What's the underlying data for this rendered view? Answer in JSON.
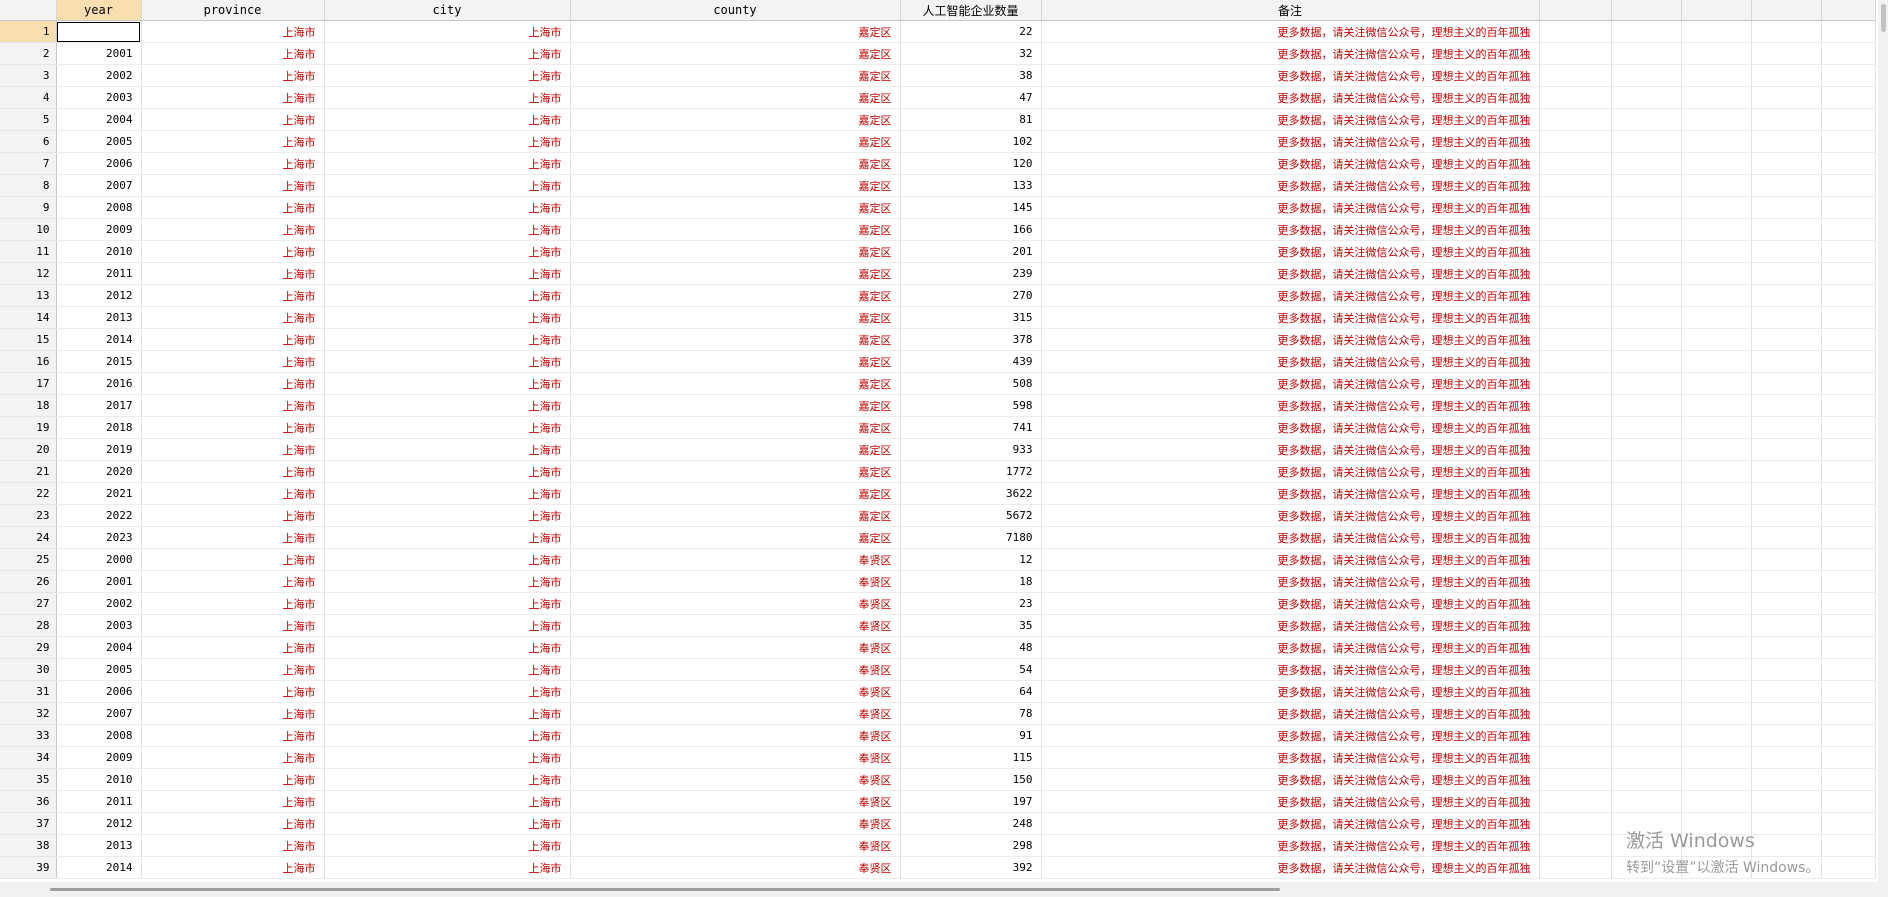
{
  "columns": [
    "year",
    "province",
    "city",
    "county",
    "人工智能企业数量",
    "备注"
  ],
  "rows": [
    [
      "",
      "上海市",
      "上海市",
      "嘉定区",
      "22",
      "更多数据，请关注微信公众号，理想主义的百年孤独"
    ],
    [
      "2001",
      "上海市",
      "上海市",
      "嘉定区",
      "32",
      "更多数据，请关注微信公众号，理想主义的百年孤独"
    ],
    [
      "2002",
      "上海市",
      "上海市",
      "嘉定区",
      "38",
      "更多数据，请关注微信公众号，理想主义的百年孤独"
    ],
    [
      "2003",
      "上海市",
      "上海市",
      "嘉定区",
      "47",
      "更多数据，请关注微信公众号，理想主义的百年孤独"
    ],
    [
      "2004",
      "上海市",
      "上海市",
      "嘉定区",
      "81",
      "更多数据，请关注微信公众号，理想主义的百年孤独"
    ],
    [
      "2005",
      "上海市",
      "上海市",
      "嘉定区",
      "102",
      "更多数据，请关注微信公众号，理想主义的百年孤独"
    ],
    [
      "2006",
      "上海市",
      "上海市",
      "嘉定区",
      "120",
      "更多数据，请关注微信公众号，理想主义的百年孤独"
    ],
    [
      "2007",
      "上海市",
      "上海市",
      "嘉定区",
      "133",
      "更多数据，请关注微信公众号，理想主义的百年孤独"
    ],
    [
      "2008",
      "上海市",
      "上海市",
      "嘉定区",
      "145",
      "更多数据，请关注微信公众号，理想主义的百年孤独"
    ],
    [
      "2009",
      "上海市",
      "上海市",
      "嘉定区",
      "166",
      "更多数据，请关注微信公众号，理想主义的百年孤独"
    ],
    [
      "2010",
      "上海市",
      "上海市",
      "嘉定区",
      "201",
      "更多数据，请关注微信公众号，理想主义的百年孤独"
    ],
    [
      "2011",
      "上海市",
      "上海市",
      "嘉定区",
      "239",
      "更多数据，请关注微信公众号，理想主义的百年孤独"
    ],
    [
      "2012",
      "上海市",
      "上海市",
      "嘉定区",
      "270",
      "更多数据，请关注微信公众号，理想主义的百年孤独"
    ],
    [
      "2013",
      "上海市",
      "上海市",
      "嘉定区",
      "315",
      "更多数据，请关注微信公众号，理想主义的百年孤独"
    ],
    [
      "2014",
      "上海市",
      "上海市",
      "嘉定区",
      "378",
      "更多数据，请关注微信公众号，理想主义的百年孤独"
    ],
    [
      "2015",
      "上海市",
      "上海市",
      "嘉定区",
      "439",
      "更多数据，请关注微信公众号，理想主义的百年孤独"
    ],
    [
      "2016",
      "上海市",
      "上海市",
      "嘉定区",
      "508",
      "更多数据，请关注微信公众号，理想主义的百年孤独"
    ],
    [
      "2017",
      "上海市",
      "上海市",
      "嘉定区",
      "598",
      "更多数据，请关注微信公众号，理想主义的百年孤独"
    ],
    [
      "2018",
      "上海市",
      "上海市",
      "嘉定区",
      "741",
      "更多数据，请关注微信公众号，理想主义的百年孤独"
    ],
    [
      "2019",
      "上海市",
      "上海市",
      "嘉定区",
      "933",
      "更多数据，请关注微信公众号，理想主义的百年孤独"
    ],
    [
      "2020",
      "上海市",
      "上海市",
      "嘉定区",
      "1772",
      "更多数据，请关注微信公众号，理想主义的百年孤独"
    ],
    [
      "2021",
      "上海市",
      "上海市",
      "嘉定区",
      "3622",
      "更多数据，请关注微信公众号，理想主义的百年孤独"
    ],
    [
      "2022",
      "上海市",
      "上海市",
      "嘉定区",
      "5672",
      "更多数据，请关注微信公众号，理想主义的百年孤独"
    ],
    [
      "2023",
      "上海市",
      "上海市",
      "嘉定区",
      "7180",
      "更多数据，请关注微信公众号，理想主义的百年孤独"
    ],
    [
      "2000",
      "上海市",
      "上海市",
      "奉贤区",
      "12",
      "更多数据，请关注微信公众号，理想主义的百年孤独"
    ],
    [
      "2001",
      "上海市",
      "上海市",
      "奉贤区",
      "18",
      "更多数据，请关注微信公众号，理想主义的百年孤独"
    ],
    [
      "2002",
      "上海市",
      "上海市",
      "奉贤区",
      "23",
      "更多数据，请关注微信公众号，理想主义的百年孤独"
    ],
    [
      "2003",
      "上海市",
      "上海市",
      "奉贤区",
      "35",
      "更多数据，请关注微信公众号，理想主义的百年孤独"
    ],
    [
      "2004",
      "上海市",
      "上海市",
      "奉贤区",
      "48",
      "更多数据，请关注微信公众号，理想主义的百年孤独"
    ],
    [
      "2005",
      "上海市",
      "上海市",
      "奉贤区",
      "54",
      "更多数据，请关注微信公众号，理想主义的百年孤独"
    ],
    [
      "2006",
      "上海市",
      "上海市",
      "奉贤区",
      "64",
      "更多数据，请关注微信公众号，理想主义的百年孤独"
    ],
    [
      "2007",
      "上海市",
      "上海市",
      "奉贤区",
      "78",
      "更多数据，请关注微信公众号，理想主义的百年孤独"
    ],
    [
      "2008",
      "上海市",
      "上海市",
      "奉贤区",
      "91",
      "更多数据，请关注微信公众号，理想主义的百年孤独"
    ],
    [
      "2009",
      "上海市",
      "上海市",
      "奉贤区",
      "115",
      "更多数据，请关注微信公众号，理想主义的百年孤独"
    ],
    [
      "2010",
      "上海市",
      "上海市",
      "奉贤区",
      "150",
      "更多数据，请关注微信公众号，理想主义的百年孤独"
    ],
    [
      "2011",
      "上海市",
      "上海市",
      "奉贤区",
      "197",
      "更多数据，请关注微信公众号，理想主义的百年孤独"
    ],
    [
      "2012",
      "上海市",
      "上海市",
      "奉贤区",
      "248",
      "更多数据，请关注微信公众号，理想主义的百年孤独"
    ],
    [
      "2013",
      "上海市",
      "上海市",
      "奉贤区",
      "298",
      "更多数据，请关注微信公众号，理想主义的百年孤独"
    ],
    [
      "2014",
      "上海市",
      "上海市",
      "奉贤区",
      "392",
      "更多数据，请关注微信公众号，理想主义的百年孤独"
    ]
  ],
  "watermark": {
    "title": "激活 Windows",
    "subtitle": "转到“设置”以激活 Windows。"
  },
  "colors": {
    "text_red": "#c00000",
    "header_bg": "#f3f3f3",
    "selected_header_bg": "#f9dfb0"
  }
}
